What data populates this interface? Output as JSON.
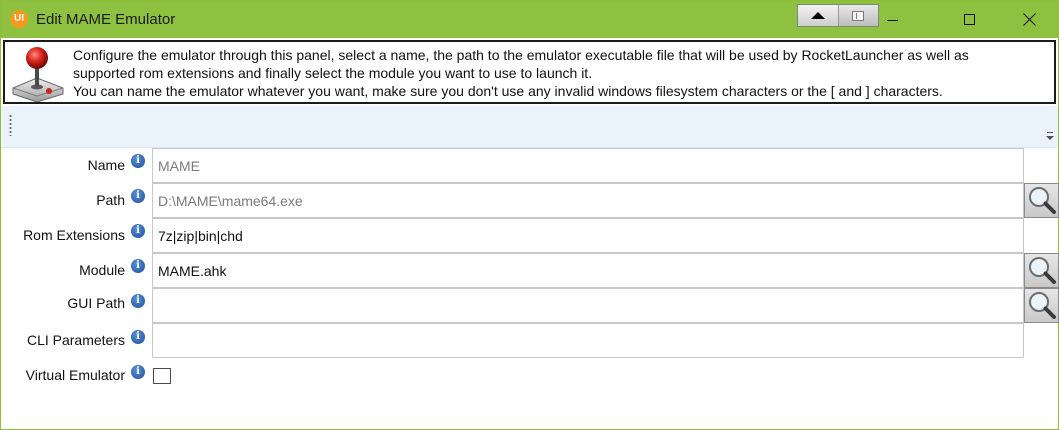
{
  "window": {
    "title": "Edit MAME Emulator",
    "icon_text": "UI"
  },
  "titlebar_buttons": [
    "move-up-icon",
    "pin-icon",
    "minimize-icon",
    "maximize-icon",
    "close-icon"
  ],
  "info": {
    "lines": [
      "Configure the emulator through this panel, select a name, the path to the emulator executable file that will be used by RocketLauncher as well as",
      "supported rom extensions and finally select the module you want to use to launch it.",
      "You can name the emulator whatever you want, make sure you don't use any invalid windows filesystem characters or the [ and ] characters."
    ]
  },
  "form": {
    "name": {
      "label": "Name",
      "value": "MAME"
    },
    "path": {
      "label": "Path",
      "value": "D:\\MAME\\mame64.exe"
    },
    "rom_extensions": {
      "label": "Rom Extensions",
      "value": "7z|zip|bin|chd"
    },
    "module": {
      "label": "Module",
      "value": "MAME.ahk"
    },
    "gui_path": {
      "label": "GUI Path",
      "value": ""
    },
    "cli_parameters": {
      "label": "CLI Parameters",
      "value": ""
    },
    "virtual_emulator": {
      "label": "Virtual Emulator",
      "checked": false
    }
  },
  "colors": {
    "titlebar": "#8ec140",
    "toolbar_strip": "#eaf2fb",
    "info_icon": "#1c4f9c",
    "app_icon": "#f39a1e"
  }
}
